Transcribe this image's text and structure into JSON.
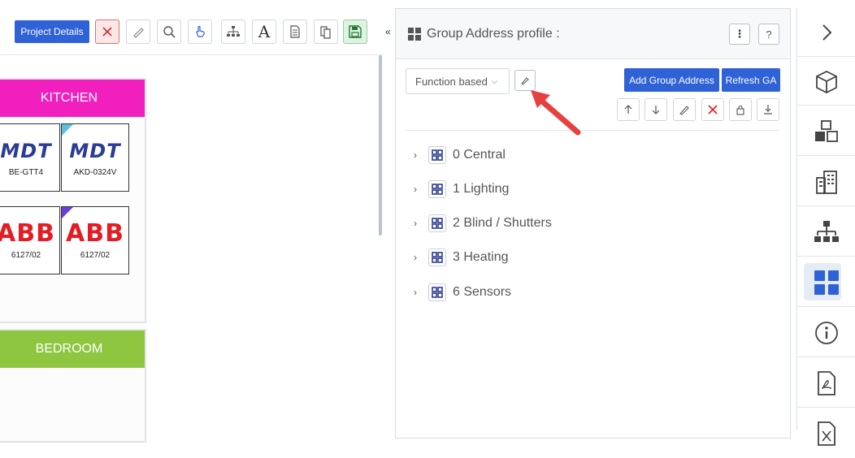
{
  "toolbar": {
    "project_details_label": "Project Details",
    "icons": [
      "close-icon",
      "pencil-icon",
      "search-icon",
      "touch-icon",
      "hierarchy-icon",
      "text-icon",
      "document-icon",
      "copy-icon",
      "save-icon"
    ]
  },
  "rooms": [
    {
      "name": "KITCHEN",
      "color": "#f01fbd"
    },
    {
      "name": "BEDROOM",
      "color": "#8ec63f"
    }
  ],
  "devices": [
    {
      "brand": "MDT",
      "model": "BE-GTT4"
    },
    {
      "brand": "MDT",
      "model": "AKD-0324V",
      "corner_color": "#5bc0de"
    },
    {
      "brand": "ABB",
      "model": "6127/02"
    },
    {
      "brand": "ABB",
      "model": "6127/02",
      "corner_color": "#6a3fd6"
    }
  ],
  "ga_panel": {
    "title": "Group Address profile :",
    "more_label": "⋮",
    "help_label": "?",
    "profile_select": "Function based",
    "add_button": "Add Group Address",
    "refresh_button": "Refresh GA",
    "tree": [
      {
        "label": "0 Central"
      },
      {
        "label": "1 Lighting"
      },
      {
        "label": "2 Blind / Shutters"
      },
      {
        "label": "3 Heating"
      },
      {
        "label": "6 Sensors"
      }
    ]
  },
  "sidebar": {
    "items": [
      "chevron-right-icon",
      "cube-icon",
      "cubes-icon",
      "building-icon",
      "hierarchy-icon",
      "grid-icon",
      "info-icon",
      "pdf-icon",
      "xls-icon"
    ],
    "active": "grid-icon"
  },
  "colors": {
    "accent": "#2f62d6",
    "danger": "#e51c23",
    "arrow": "#e84040"
  }
}
